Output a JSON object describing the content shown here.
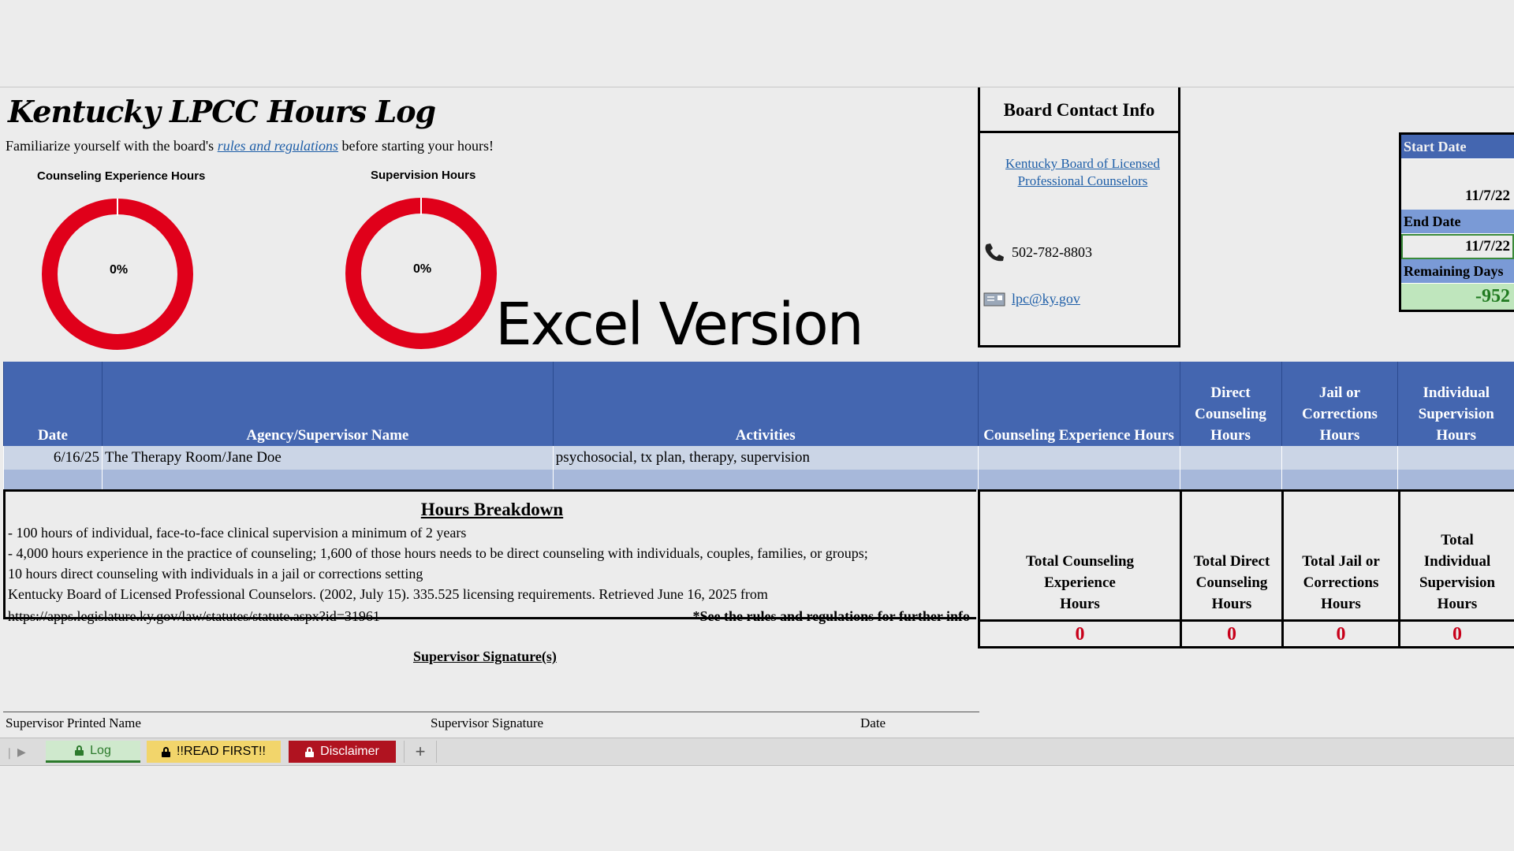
{
  "header": {
    "title": "Kentucky LPCC Hours Log",
    "intro_before": "Familiarize yourself with the board's",
    "intro_link": "rules and regulations",
    "intro_after": "before starting your hours!"
  },
  "gauges": [
    {
      "label": "Counseling Experience Hours",
      "percent_text": "0%",
      "percent": 0
    },
    {
      "label": "Supervision Hours",
      "percent_text": "0%",
      "percent": 0
    }
  ],
  "watermark": "Excel Version",
  "contact": {
    "heading": "Board Contact Info",
    "board_link": "Kentucky Board of Licensed Professional Counselors",
    "phone": "502-782-8803",
    "email": "lpc@ky.gov",
    "phone_icon": "phone-icon",
    "email_icon": "envelope-icon"
  },
  "dates": {
    "start_label": "Start Date",
    "start_value": "11/7/22",
    "end_label": "End Date",
    "end_value": "11/7/22",
    "remaining_label": "Remaining Days",
    "remaining_value": "-952"
  },
  "table": {
    "columns": [
      "Date",
      "Agency/Supervisor Name",
      "Activities",
      "Counseling Experience Hours",
      "Direct Counseling Hours",
      "Jail or Corrections Hours",
      "Individual Supervision Hours"
    ],
    "rows": [
      {
        "date": "6/16/25",
        "agency": "The Therapy Room/Jane Doe",
        "activities": "psychosocial, tx plan, therapy, supervision",
        "counseling": "",
        "direct": "",
        "jail": "",
        "supervision": ""
      }
    ]
  },
  "breakdown": {
    "title": "Hours Breakdown",
    "lines": [
      "- 100 hours of individual, face-to-face clinical supervision a minimum of 2 years",
      "- 4,000 hours experience in the practice of counseling; 1,600 of those hours needs to be direct counseling with individuals, couples, families, or groups;",
      "10 hours direct counseling with individuals in a jail or corrections setting",
      "Kentucky Board of Licensed Professional Counselors. (2002, July 15). 335.525 licensing requirements. Retrieved June 16, 2025 from",
      "https://apps.legislature.ky.gov/law/statutes/statute.aspx?id=31961"
    ],
    "note": "*See the rules and regulations for further info"
  },
  "totals": [
    {
      "label": "Total Counseling Experience Hours",
      "value": "0"
    },
    {
      "label": "Total Direct Counseling Hours",
      "value": "0"
    },
    {
      "label": "Total Jail or Corrections Hours",
      "value": "0"
    },
    {
      "label": "Total Individual Supervision Hours",
      "value": "0"
    }
  ],
  "signature": {
    "title": "Supervisor Signature(s)",
    "printed_name": "Supervisor Printed Name",
    "signature": "Supervisor Signature",
    "date": "Date"
  },
  "tabs": [
    {
      "label": "Log",
      "color": "#cfe9cd",
      "text_color": "#2c7a2c"
    },
    {
      "label": "!!READ FIRST!!",
      "color": "#f2d56b",
      "text_color": "#000000"
    },
    {
      "label": "Disclaimer",
      "color": "#b01320",
      "text_color": "#ffffff"
    }
  ],
  "colors": {
    "header_blue": "#4466b0",
    "gauge_red": "#e0001a",
    "total_red": "#c8001a",
    "link_blue": "#1f5fa8"
  }
}
